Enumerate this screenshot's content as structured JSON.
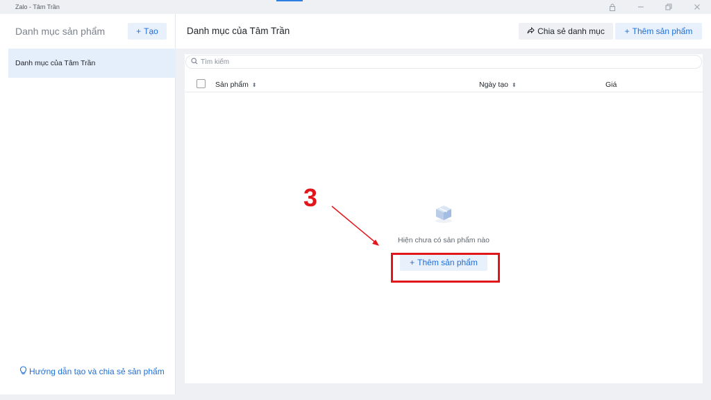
{
  "window": {
    "title": "Zalo - Tâm Trần",
    "controls": [
      "lock-icon",
      "minimize-icon",
      "restore-icon",
      "close-icon"
    ]
  },
  "sidebar": {
    "title": "Danh mục sản phẩm",
    "create_label": "Tạo",
    "items": [
      {
        "label": "Danh mục của Tâm Trần",
        "selected": true
      }
    ],
    "guide_label": "Hướng dẫn tạo và chia sẻ sản phẩm"
  },
  "main": {
    "title": "Danh mục của Tâm Trần",
    "share_label": "Chia sẻ danh mục",
    "add_label": "Thêm sản phẩm",
    "search_placeholder": "Tìm kiếm",
    "columns": [
      "Sản phẩm",
      "Ngày tạo",
      "Giá"
    ],
    "empty_text": "Hiện chưa có sản phẩm nào",
    "empty_add_label": "Thêm sản phẩm"
  },
  "annotation": {
    "step_number": "3",
    "color": "#e0161b"
  },
  "colors": {
    "accent": "#1d6fd8",
    "selected_bg": "#e5eefb",
    "button_bg": "#e8f0fc"
  }
}
